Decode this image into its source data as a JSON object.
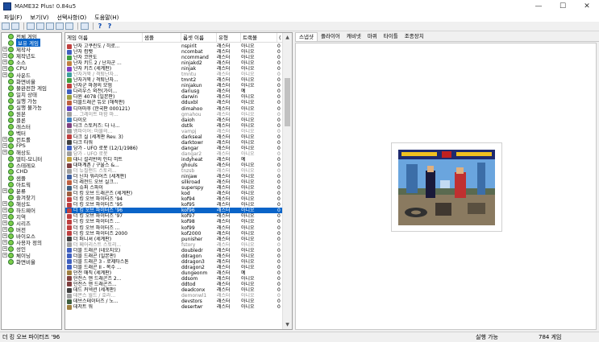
{
  "window": {
    "title": "MAME32 Plus! 0.84u5",
    "minimize": "—",
    "maximize": "☐",
    "close": "✕"
  },
  "menu": [
    "파일(F)",
    "보기(V)",
    "선택사항(O)",
    "도움말(H)"
  ],
  "toolbar": {
    "help_icon": "?",
    "whatsthis_icon": "?"
  },
  "folders": [
    {
      "label": "전체 게임",
      "exp": ""
    },
    {
      "label": "보유 게임",
      "exp": "",
      "selected": true
    },
    {
      "label": "제작사",
      "exp": "+"
    },
    {
      "label": "제작년도",
      "exp": "+"
    },
    {
      "label": "소스",
      "exp": "+"
    },
    {
      "label": "CPU",
      "exp": "+"
    },
    {
      "label": "사운드",
      "exp": "+"
    },
    {
      "label": "화면비율",
      "exp": ""
    },
    {
      "label": "불완전한 게임",
      "exp": ""
    },
    {
      "label": "일치 상태",
      "exp": ""
    },
    {
      "label": "실행 가능",
      "exp": ""
    },
    {
      "label": "실행 불가능",
      "exp": ""
    },
    {
      "label": "원본",
      "exp": ""
    },
    {
      "label": "클론",
      "exp": ""
    },
    {
      "label": "래스터",
      "exp": ""
    },
    {
      "label": "벡터",
      "exp": ""
    },
    {
      "label": "컨트롤",
      "exp": "+"
    },
    {
      "label": "FPS",
      "exp": "+"
    },
    {
      "label": "해상도",
      "exp": "+"
    },
    {
      "label": "멀티-모니터",
      "exp": ""
    },
    {
      "label": "스테레오",
      "exp": ""
    },
    {
      "label": "CHD",
      "exp": ""
    },
    {
      "label": "샘플",
      "exp": ""
    },
    {
      "label": "아트웍",
      "exp": ""
    },
    {
      "label": "분류",
      "exp": "+"
    },
    {
      "label": "즐겨찾기",
      "exp": ""
    },
    {
      "label": "해상도",
      "exp": "+"
    },
    {
      "label": "하드웨어",
      "exp": "+"
    },
    {
      "label": "지역",
      "exp": "+"
    },
    {
      "label": "시리즈",
      "exp": "+"
    },
    {
      "label": "버전",
      "exp": "+"
    },
    {
      "label": "바이오스",
      "exp": "+"
    },
    {
      "label": "사용자 정의",
      "exp": "+"
    },
    {
      "label": "성인",
      "exp": "+"
    },
    {
      "label": "체이닝",
      "exp": "+"
    },
    {
      "label": "화면비율",
      "exp": ""
    }
  ],
  "list": {
    "columns": [
      "게임 이름",
      "샘플",
      "롬셋 이름",
      "유형",
      "트랙볼",
      "("
    ],
    "rows": [
      {
        "name": "난자 고쿠린도 / 히로...",
        "rom": "nspirit",
        "type": "래스터",
        "trk": "아니오",
        "n": "0",
        "icolor": "#c04040"
      },
      {
        "name": "난자 컴뱃",
        "rom": "ncombat",
        "type": "래스터",
        "trk": "아니오",
        "n": "0",
        "icolor": "#4060c0"
      },
      {
        "name": "난자 코만도",
        "rom": "ncommand",
        "type": "래스터",
        "trk": "아니오",
        "n": "0",
        "icolor": "#40a040"
      },
      {
        "name": "난자 키드 2 / 난자군 ...",
        "rom": "ninjakd2",
        "type": "래스터",
        "trk": "아니오",
        "n": "0",
        "icolor": "#c08040"
      },
      {
        "name": "난자 키즈 (세계판)",
        "rom": "ninjak",
        "type": "래스터",
        "trk": "아니오",
        "n": "0",
        "icolor": "#8040c0"
      },
      {
        "name": "난자거북 / 격퇴난자...",
        "rom": "tmntu",
        "type": "래스터",
        "trk": "아니오",
        "n": "0",
        "icolor": "#40a0a0",
        "gray": true
      },
      {
        "name": "난자거북 / 격퇴난자...",
        "rom": "tmnt2",
        "type": "래스터",
        "trk": "아니오",
        "n": "0",
        "icolor": "#40a040"
      },
      {
        "name": "난자군 마경의 모험",
        "rom": "ninjakun",
        "type": "래스터",
        "trk": "아니오",
        "n": "0",
        "icolor": "#c04040"
      },
      {
        "name": "다리우스 외전(가이...",
        "rom": "dariusg",
        "type": "래스터",
        "trk": "예",
        "n": "0",
        "icolor": "#4060c0"
      },
      {
        "name": "다윈 4078 (일본판)",
        "rom": "darwin",
        "type": "래스터",
        "trk": "아니오",
        "n": "0",
        "icolor": "#a0a040"
      },
      {
        "name": "더블드래곤 듀오 (해적판)",
        "rom": "dduxbl",
        "type": "래스터",
        "trk": "아니오",
        "n": "0",
        "icolor": "#c06040"
      },
      {
        "name": "디아마후 (한국판 000121)",
        "rom": "dimahoo",
        "type": "래스터",
        "trk": "아니오",
        "n": "0",
        "icolor": "#6040c0"
      },
      {
        "name": "... 그레이트 마함 마...",
        "rom": "gmahou",
        "type": "래스터",
        "trk": "아니오",
        "n": "0",
        "icolor": "#a0a0a0",
        "gray": true
      },
      {
        "name": "다이오",
        "rom": "daioh",
        "type": "래스터",
        "trk": "아니오",
        "n": "0",
        "icolor": "#4080c0"
      },
      {
        "name": "다크 스토커즈: 다 나...",
        "rom": "dstlk",
        "type": "래스터",
        "trk": "아니오",
        "n": "0",
        "icolor": "#804080"
      },
      {
        "name": "뱀파이어: 마물의...",
        "rom": "vampj",
        "type": "래스터",
        "trk": "아니오",
        "n": "0",
        "icolor": "#a0a0a0",
        "gray": true
      },
      {
        "name": "다크 실 (세계판 Rev. 3)",
        "rom": "darkseal",
        "type": "래스터",
        "trk": "아니오",
        "n": "0",
        "icolor": "#c04040"
      },
      {
        "name": "다크 타워",
        "rom": "darktowr",
        "type": "래스터",
        "trk": "아니오",
        "n": "0",
        "icolor": "#404040"
      },
      {
        "name": "당가 - UFO 로봇 (12/1/1986)",
        "rom": "dangar",
        "type": "래스터",
        "trk": "아니오",
        "n": "0",
        "icolor": "#4060c0"
      },
      {
        "name": "당가 - UFO 로봇",
        "rom": "dangar2",
        "type": "래스터",
        "trk": "아니오",
        "n": "0",
        "icolor": "#a0a0a0",
        "gray": true
      },
      {
        "name": "대니 설리반의 인디 히트",
        "rom": "indyheat",
        "type": "래스터",
        "trk": "예",
        "n": "0",
        "icolor": "#c0a040"
      },
      {
        "name": "대마계촌 / 구울스 &...",
        "rom": "ghouls",
        "type": "래스터",
        "trk": "아니오",
        "n": "0",
        "icolor": "#804040"
      },
      {
        "name": "더 뉴질랜드 스토리...",
        "rom": "tnzsb",
        "type": "래스터",
        "trk": "아니오",
        "n": "0",
        "icolor": "#a0a0a0",
        "gray": true
      },
      {
        "name": "더 닌자 워리어즈 (세계판)",
        "rom": "ninjaw",
        "type": "래스터",
        "trk": "아니오",
        "n": "0",
        "icolor": "#4060a0"
      },
      {
        "name": "더 레전드 오브 실크...",
        "rom": "silkroad",
        "type": "래스터",
        "trk": "아니오",
        "n": "0",
        "icolor": "#c06040"
      },
      {
        "name": "더 슈퍼 스파이",
        "rom": "superspy",
        "type": "래스터",
        "trk": "아니오",
        "n": "0",
        "icolor": "#406080"
      },
      {
        "name": "더 킹 오브 드래곤즈 (세계판)",
        "rom": "kod",
        "type": "래스터",
        "trk": "아니오",
        "n": "0",
        "icolor": "#a06040"
      },
      {
        "name": "더 킹 오브 파이터즈 '94",
        "rom": "kof94",
        "type": "래스터",
        "trk": "아니오",
        "n": "0",
        "icolor": "#c04040"
      },
      {
        "name": "더 킹 오브 파이터즈 '95",
        "rom": "kof95",
        "type": "래스터",
        "trk": "아니오",
        "n": "0",
        "icolor": "#c04040"
      },
      {
        "name": "더 킹 오브 파이터즈 '96",
        "rom": "kof96",
        "type": "래스터",
        "trk": "아니오",
        "n": "0",
        "icolor": "#c04040",
        "selected": true
      },
      {
        "name": "더 킹 오브 파이터즈 '97",
        "rom": "kof97",
        "type": "래스터",
        "trk": "아니오",
        "n": "0",
        "icolor": "#c04040"
      },
      {
        "name": "더 킹 오브 파이터즈 ...",
        "rom": "kof98",
        "type": "래스터",
        "trk": "아니오",
        "n": "0",
        "icolor": "#c04040"
      },
      {
        "name": "더 킹 오브 파이터즈 ...",
        "rom": "kof99",
        "type": "래스터",
        "trk": "아니오",
        "n": "0",
        "icolor": "#c04040"
      },
      {
        "name": "더 킹 오브 파이터즈 2000",
        "rom": "kof2000",
        "type": "래스터",
        "trk": "아니오",
        "n": "0",
        "icolor": "#c04040"
      },
      {
        "name": "더 퍼니셔 (세계판)",
        "rom": "punisher",
        "type": "래스터",
        "trk": "아니오",
        "n": "0",
        "icolor": "#404040"
      },
      {
        "name": "더 페어리스트 스토리...",
        "rom": "fstory",
        "type": "래스터",
        "trk": "아니오",
        "n": "0",
        "icolor": "#a0a0a0",
        "gray": true
      },
      {
        "name": "더블 드래곤 (네오지오)",
        "rom": "doubledr",
        "type": "래스터",
        "trk": "아니오",
        "n": "0",
        "icolor": "#4060c0"
      },
      {
        "name": "더블 드래곤 (일본판)",
        "rom": "ddragon",
        "type": "래스터",
        "trk": "아니오",
        "n": "0",
        "icolor": "#4060c0"
      },
      {
        "name": "더블 드래곤 3 - 로제타스톤",
        "rom": "ddragon3",
        "type": "래스터",
        "trk": "아니오",
        "n": "0",
        "icolor": "#4060c0"
      },
      {
        "name": "더블 드래곤 II - 복수 ...",
        "rom": "ddragon2",
        "type": "래스터",
        "trk": "아니오",
        "n": "0",
        "icolor": "#4060c0"
      },
      {
        "name": "던전 매직 (세계판)",
        "rom": "dungeonm",
        "type": "래스터",
        "trk": "예",
        "n": "0",
        "icolor": "#a08040"
      },
      {
        "name": "던전스 앤 드래곤즈 2...",
        "rom": "ddsom",
        "type": "래스터",
        "trk": "아니오",
        "n": "0",
        "icolor": "#804040"
      },
      {
        "name": "던전스 앤 드래곤즈...",
        "rom": "ddtod",
        "type": "래스터",
        "trk": "아니오",
        "n": "0",
        "icolor": "#804040"
      },
      {
        "name": "데드 커넥션 (세계판)",
        "rom": "deadconx",
        "type": "래스터",
        "trk": "아니오",
        "n": "0",
        "icolor": "#404040"
      },
      {
        "name": "데몬스 월드 / 호라...",
        "rom": "demonwl1",
        "type": "래스터",
        "trk": "아니오",
        "n": "0",
        "icolor": "#a0a0a0",
        "gray": true
      },
      {
        "name": "데브스테이터즈 / 노...",
        "rom": "devstors",
        "type": "래스터",
        "trk": "아니오",
        "n": "0",
        "icolor": "#406040"
      },
      {
        "name": "데저트 워",
        "rom": "desertwr",
        "type": "래스터",
        "trk": "아니오",
        "n": "0",
        "icolor": "#a08040"
      }
    ]
  },
  "tabs": [
    {
      "label": "스냅샷",
      "active": true
    },
    {
      "label": "플라이어"
    },
    {
      "label": "캐비넷"
    },
    {
      "label": "마퀴"
    },
    {
      "label": "타이틀"
    },
    {
      "label": "조종장치"
    }
  ],
  "status": {
    "selected_game": "더 킹 오브 파이터즈 '96",
    "state": "실행 가능",
    "count": "784 게임"
  },
  "colors": {
    "selection": "#0a64c8",
    "folder_icon": "#7ccd4a"
  }
}
